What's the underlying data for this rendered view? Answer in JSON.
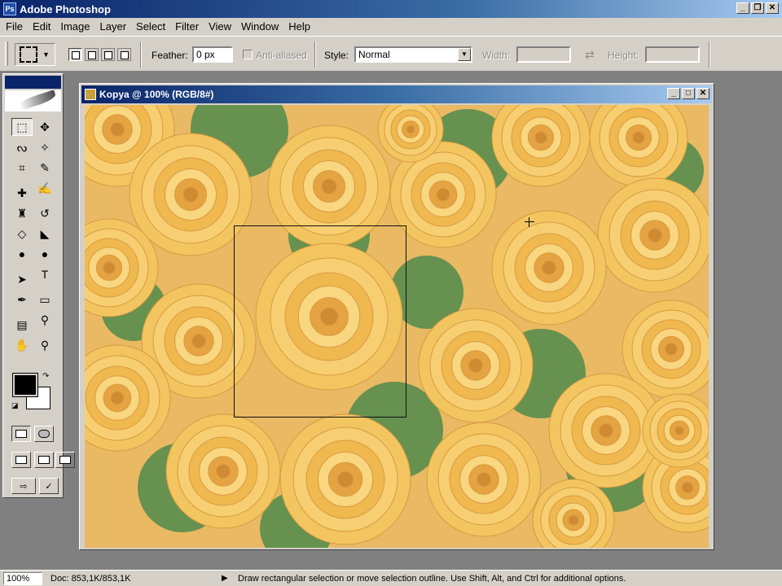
{
  "app": {
    "title": "Adobe Photoshop",
    "window_buttons": {
      "minimize": "_",
      "restore": "❐",
      "close": "✕"
    }
  },
  "menu": [
    "File",
    "Edit",
    "Image",
    "Layer",
    "Select",
    "Filter",
    "View",
    "Window",
    "Help"
  ],
  "options": {
    "feather_label": "Feather:",
    "feather_value": "0 px",
    "antialiased_label": "Anti-aliased",
    "antialiased_checked": false,
    "style_label": "Style:",
    "style_value": "Normal",
    "width_label": "Width:",
    "height_label": "Height:",
    "width_value": "",
    "height_value": ""
  },
  "tools": [
    {
      "name": "rectangular-marquee-tool",
      "glyph": "⬚",
      "active": true
    },
    {
      "name": "move-tool",
      "glyph": "✥"
    },
    {
      "name": "lasso-tool",
      "glyph": "ᔓ"
    },
    {
      "name": "magic-wand-tool",
      "glyph": "✧"
    },
    {
      "name": "crop-tool",
      "glyph": "⌗"
    },
    {
      "name": "slice-tool",
      "glyph": "✎"
    },
    {
      "name": "healing-brush-tool",
      "glyph": "✚"
    },
    {
      "name": "brush-tool",
      "glyph": "✍"
    },
    {
      "name": "clone-stamp-tool",
      "glyph": "♜"
    },
    {
      "name": "history-brush-tool",
      "glyph": "↺"
    },
    {
      "name": "eraser-tool",
      "glyph": "◇"
    },
    {
      "name": "paint-bucket-tool",
      "glyph": "◣"
    },
    {
      "name": "blur-tool",
      "glyph": "●"
    },
    {
      "name": "burn-tool",
      "glyph": "●"
    },
    {
      "name": "path-selection-tool",
      "glyph": "➤"
    },
    {
      "name": "type-tool",
      "glyph": "T"
    },
    {
      "name": "pen-tool",
      "glyph": "✒"
    },
    {
      "name": "rectangle-tool",
      "glyph": "▭"
    },
    {
      "name": "notes-tool",
      "glyph": "▤"
    },
    {
      "name": "eyedropper-tool",
      "glyph": "⚲"
    },
    {
      "name": "hand-tool",
      "glyph": "✋"
    },
    {
      "name": "zoom-tool",
      "glyph": "⚲"
    }
  ],
  "colors": {
    "foreground": "#000000",
    "background": "#ffffff",
    "accent": "#0a246a"
  },
  "document": {
    "title": "Kopya @ 100% (RGB/8#)",
    "buttons": {
      "minimize": "_",
      "maximize": "□",
      "close": "✕"
    }
  },
  "status": {
    "zoom": "100%",
    "doc": "Doc: 853,1K/853,1K",
    "arrow": "▶",
    "info": "Draw rectangular selection or move selection outline.  Use Shift, Alt, and Ctrl for additional options."
  }
}
